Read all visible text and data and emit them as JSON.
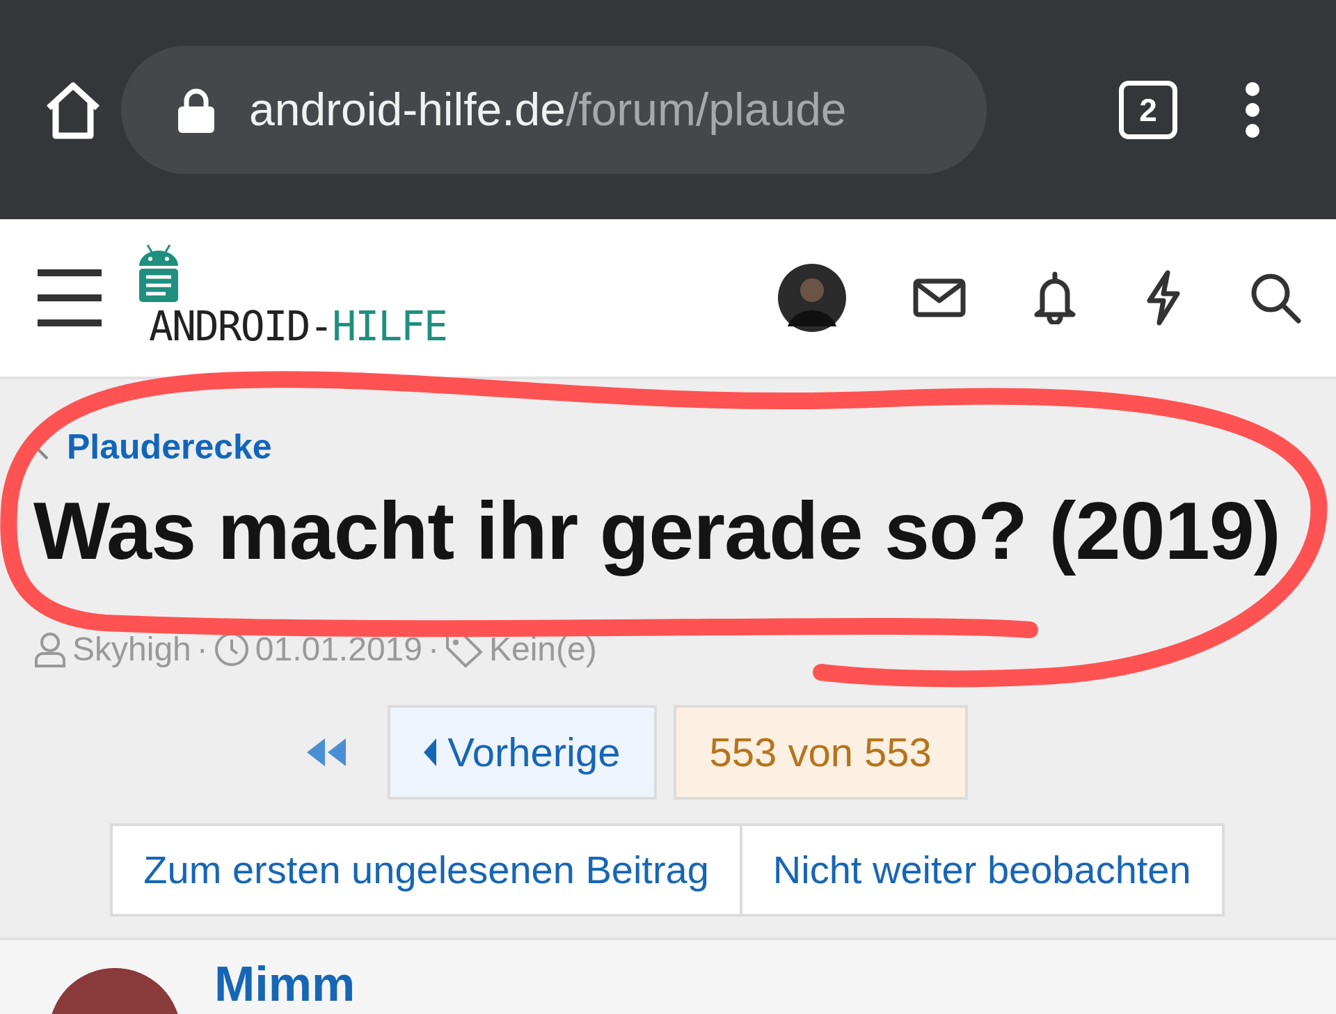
{
  "browser": {
    "url_host": "android-hilfe.de",
    "url_path": "/forum/plaude",
    "tab_count": "2"
  },
  "header": {
    "logo_dark": "ANDROID-",
    "logo_accent": "HILFE"
  },
  "breadcrumb": "Plauderecke",
  "title": "Was macht ihr gerade so? (2019)",
  "meta": {
    "author": "Skyhigh",
    "separators": [
      "·",
      "·"
    ],
    "date": "01.01.2019",
    "tags": "Kein(e)"
  },
  "pagination": {
    "previous": "Vorherige",
    "current": "553 von 553"
  },
  "actions": [
    "Zum ersten ungelesenen Beitrag",
    "Nicht weiter beobachten"
  ],
  "post": {
    "author": "Mimm"
  }
}
